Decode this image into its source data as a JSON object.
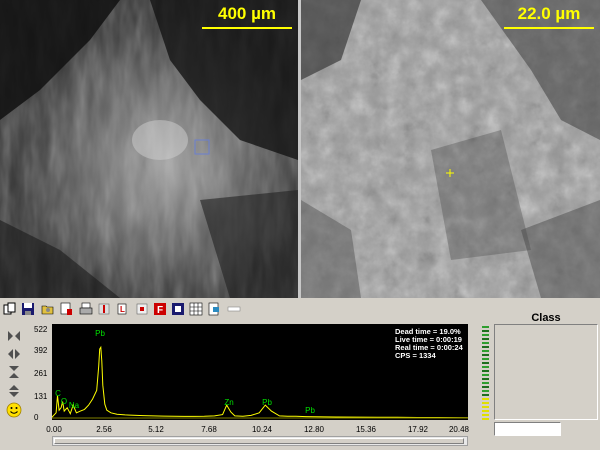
{
  "images": {
    "left": {
      "scale_label": "400 µm",
      "scale_color": "#ffff00"
    },
    "right": {
      "scale_label": "22.0 µm",
      "scale_color": "#ffff00"
    }
  },
  "toolbar": {
    "icons": [
      "copy-icon",
      "save-icon",
      "open-icon",
      "print-preview-icon",
      "print-icon",
      "marker-icon",
      "report-icon",
      "filter-f-icon",
      "frame-icon",
      "grid-icon",
      "export-icon",
      "toggle-icon"
    ]
  },
  "spectrum": {
    "info": {
      "dead_time": "Dead time = 19.0%",
      "live_time": "Live time = 0:00:19",
      "real_time": "Real time = 0:00:24",
      "cps": "CPS = 1334"
    },
    "y_ticks": [
      "522",
      "392",
      "261",
      "131",
      "0"
    ],
    "x_ticks": [
      "0.00",
      "2.56",
      "5.12",
      "7.68",
      "10.24",
      "12.80",
      "15.36",
      "17.92",
      "20.48"
    ],
    "peaks": [
      "C",
      "O",
      "Na",
      "Pb",
      "Zn",
      "Pb",
      "Pb"
    ],
    "colors": {
      "trace": "#ffff00",
      "labels": "#00e000",
      "background": "#000000"
    }
  },
  "chart_data": {
    "type": "line",
    "title": "",
    "xlabel": "",
    "ylabel": "",
    "xlim": [
      0,
      20.48
    ],
    "ylim": [
      0,
      522
    ],
    "x": [
      0.0,
      0.2,
      0.27,
      0.35,
      0.45,
      0.52,
      0.6,
      0.75,
      0.9,
      1.04,
      1.2,
      1.4,
      1.6,
      1.8,
      2.0,
      2.2,
      2.3,
      2.35,
      2.4,
      2.45,
      2.5,
      2.6,
      2.7,
      2.9,
      3.2,
      3.6,
      4.0,
      4.5,
      5.0,
      5.5,
      6.0,
      6.5,
      7.0,
      7.5,
      8.0,
      8.4,
      8.6,
      8.8,
      9.0,
      9.4,
      9.8,
      10.2,
      10.5,
      10.8,
      11.2,
      11.6,
      12.0,
      12.5,
      13.0,
      14.0,
      15.0,
      16.0,
      17.0,
      18.0,
      19.0,
      20.48
    ],
    "series": [
      {
        "values": [
          5,
          30,
          130,
          45,
          60,
          95,
          40,
          60,
          25,
          75,
          30,
          40,
          50,
          75,
          110,
          160,
          300,
          400,
          410,
          330,
          190,
          80,
          45,
          30,
          22,
          18,
          16,
          14,
          12,
          11,
          10,
          9,
          9,
          10,
          12,
          20,
          75,
          35,
          12,
          10,
          15,
          30,
          75,
          40,
          12,
          10,
          10,
          8,
          7,
          6,
          5,
          4,
          4,
          3,
          3,
          2
        ]
      }
    ]
  },
  "class_panel": {
    "title": "Class",
    "input_value": ""
  }
}
